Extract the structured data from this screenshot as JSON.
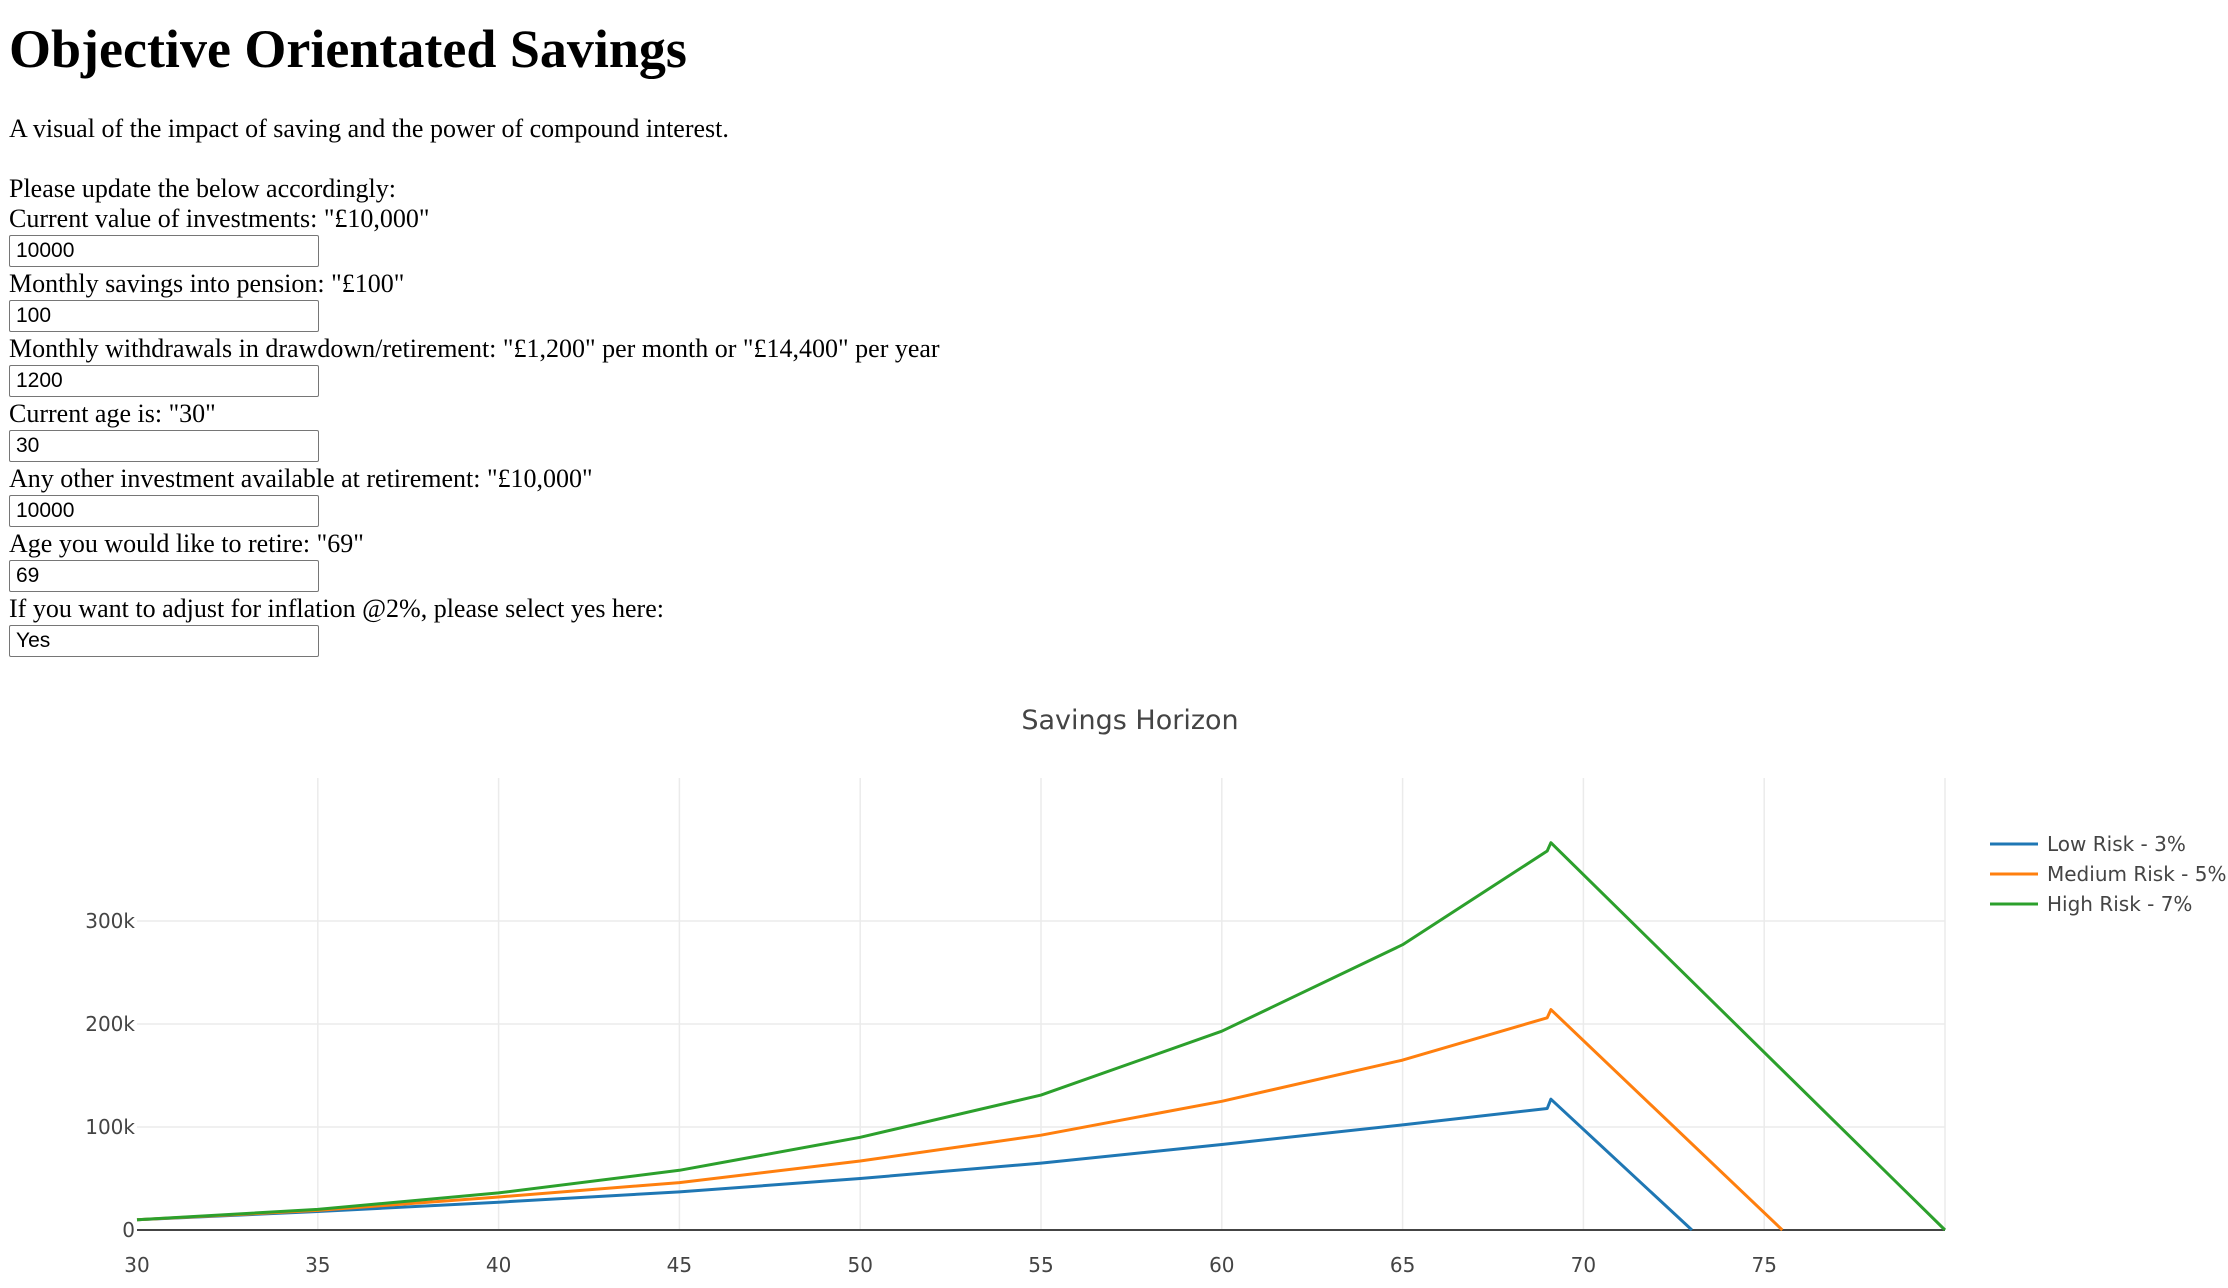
{
  "page": {
    "title": "Objective Orientated Savings",
    "intro": "A visual of the impact of saving and the power of compound interest.",
    "instruction": "Please update the below accordingly:"
  },
  "form": {
    "fields": [
      {
        "label": "Current value of investments: \"£10,000\"",
        "value": "10000"
      },
      {
        "label": "Monthly savings into pension: \"£100\"",
        "value": "100"
      },
      {
        "label": "Monthly withdrawals in drawdown/retirement: \"£1,200\" per month or \"£14,400\" per year",
        "value": "1200"
      },
      {
        "label": "Current age is: \"30\"",
        "value": "30"
      },
      {
        "label": "Any other investment available at retirement: \"£10,000\"",
        "value": "10000"
      },
      {
        "label": "Age you would like to retire: \"69\"",
        "value": "69"
      },
      {
        "label": "If you want to adjust for inflation @2%, please select yes here:",
        "value": "Yes"
      }
    ]
  },
  "chart_data": {
    "type": "line",
    "title": "Savings Horizon",
    "xlabel": "",
    "ylabel": "",
    "xlim": [
      30,
      80
    ],
    "ylim": [
      0,
      400000
    ],
    "x_ticks": [
      30,
      35,
      40,
      45,
      50,
      55,
      60,
      65,
      70,
      75
    ],
    "x_tick_labels": [
      "30",
      "35",
      "40",
      "45",
      "50",
      "55",
      "60",
      "65",
      "70",
      "75"
    ],
    "y_ticks": [
      0,
      100000,
      200000,
      300000
    ],
    "y_tick_labels": [
      "0",
      "100k",
      "200k",
      "300k"
    ],
    "grid": true,
    "legend_position": "top-right",
    "series": [
      {
        "name": "Low Risk - 3%",
        "color": "#1f77b4",
        "x": [
          30,
          35,
          40,
          45,
          50,
          55,
          60,
          65,
          69,
          69.1,
          73
        ],
        "y": [
          10000,
          18000,
          27000,
          37000,
          50000,
          65000,
          83000,
          102000,
          118000,
          127000,
          0
        ]
      },
      {
        "name": "Medium Risk - 5%",
        "color": "#ff7f0e",
        "x": [
          30,
          35,
          40,
          45,
          50,
          55,
          60,
          65,
          69,
          69.1,
          75.5
        ],
        "y": [
          10000,
          19000,
          32000,
          46000,
          67000,
          92000,
          125000,
          165000,
          206000,
          214000,
          0
        ]
      },
      {
        "name": "High Risk - 7%",
        "color": "#2ca02c",
        "x": [
          30,
          35,
          40,
          45,
          50,
          55,
          60,
          65,
          69,
          69.1,
          80
        ],
        "y": [
          10000,
          20000,
          36000,
          58000,
          90000,
          131000,
          193000,
          277000,
          368000,
          376000,
          0
        ]
      }
    ]
  }
}
